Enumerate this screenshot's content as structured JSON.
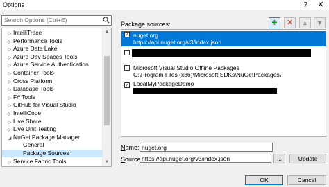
{
  "window": {
    "title": "Options",
    "help_label": "?",
    "close_label": "✕"
  },
  "search": {
    "placeholder": "Search Options (Ctrl+E)"
  },
  "tree": {
    "items": [
      {
        "label": "IntelliTrace",
        "expanded": false
      },
      {
        "label": "Performance Tools",
        "expanded": false
      },
      {
        "label": "Azure Data Lake",
        "expanded": false
      },
      {
        "label": "Azure Dev Spaces Tools",
        "expanded": false
      },
      {
        "label": "Azure Service Authentication",
        "expanded": false
      },
      {
        "label": "Container Tools",
        "expanded": false
      },
      {
        "label": "Cross Platform",
        "expanded": false
      },
      {
        "label": "Database Tools",
        "expanded": false
      },
      {
        "label": "F# Tools",
        "expanded": false
      },
      {
        "label": "GitHub for Visual Studio",
        "expanded": false
      },
      {
        "label": "IntelliCode",
        "expanded": false
      },
      {
        "label": "Live Share",
        "expanded": false
      },
      {
        "label": "Live Unit Testing",
        "expanded": false
      },
      {
        "label": "NuGet Package Manager",
        "expanded": true
      },
      {
        "label": "General",
        "child": true
      },
      {
        "label": "Package Sources",
        "child": true,
        "selected": true
      },
      {
        "label": "Service Fabric Tools",
        "expanded": false
      }
    ]
  },
  "sources": {
    "label": "Package sources:",
    "toolbar": {
      "add_icon": "plus-icon",
      "remove_icon": "x-icon",
      "up_icon": "arrow-up-icon",
      "down_icon": "arrow-down-icon"
    },
    "items": [
      {
        "name": "nuget.org",
        "url": "https://api.nuget.org/v3/index.json",
        "checked": true,
        "selected": true
      },
      {
        "name": "",
        "url": "",
        "checked": false,
        "redacted": true
      },
      {
        "name": "Microsoft Visual Studio Offline Packages",
        "url": "C:\\Program Files (x86)\\Microsoft SDKs\\NuGetPackages\\",
        "checked": false
      },
      {
        "name": "LocalMyPackageDemo",
        "url": "",
        "checked": true,
        "redacted_url": true
      }
    ]
  },
  "form": {
    "name_label": "Name:",
    "name_value": "nuget.org",
    "source_label": "Source:",
    "source_value": "https://api.nuget.org/v3/index.json",
    "browse_label": "...",
    "update_label": "Update"
  },
  "footer": {
    "ok_label": "OK",
    "cancel_label": "Cancel"
  },
  "colors": {
    "selection": "#0078d7",
    "tree_selection": "#cce8ff",
    "add_green": "#1e9a28",
    "remove_red": "#c0392b"
  }
}
